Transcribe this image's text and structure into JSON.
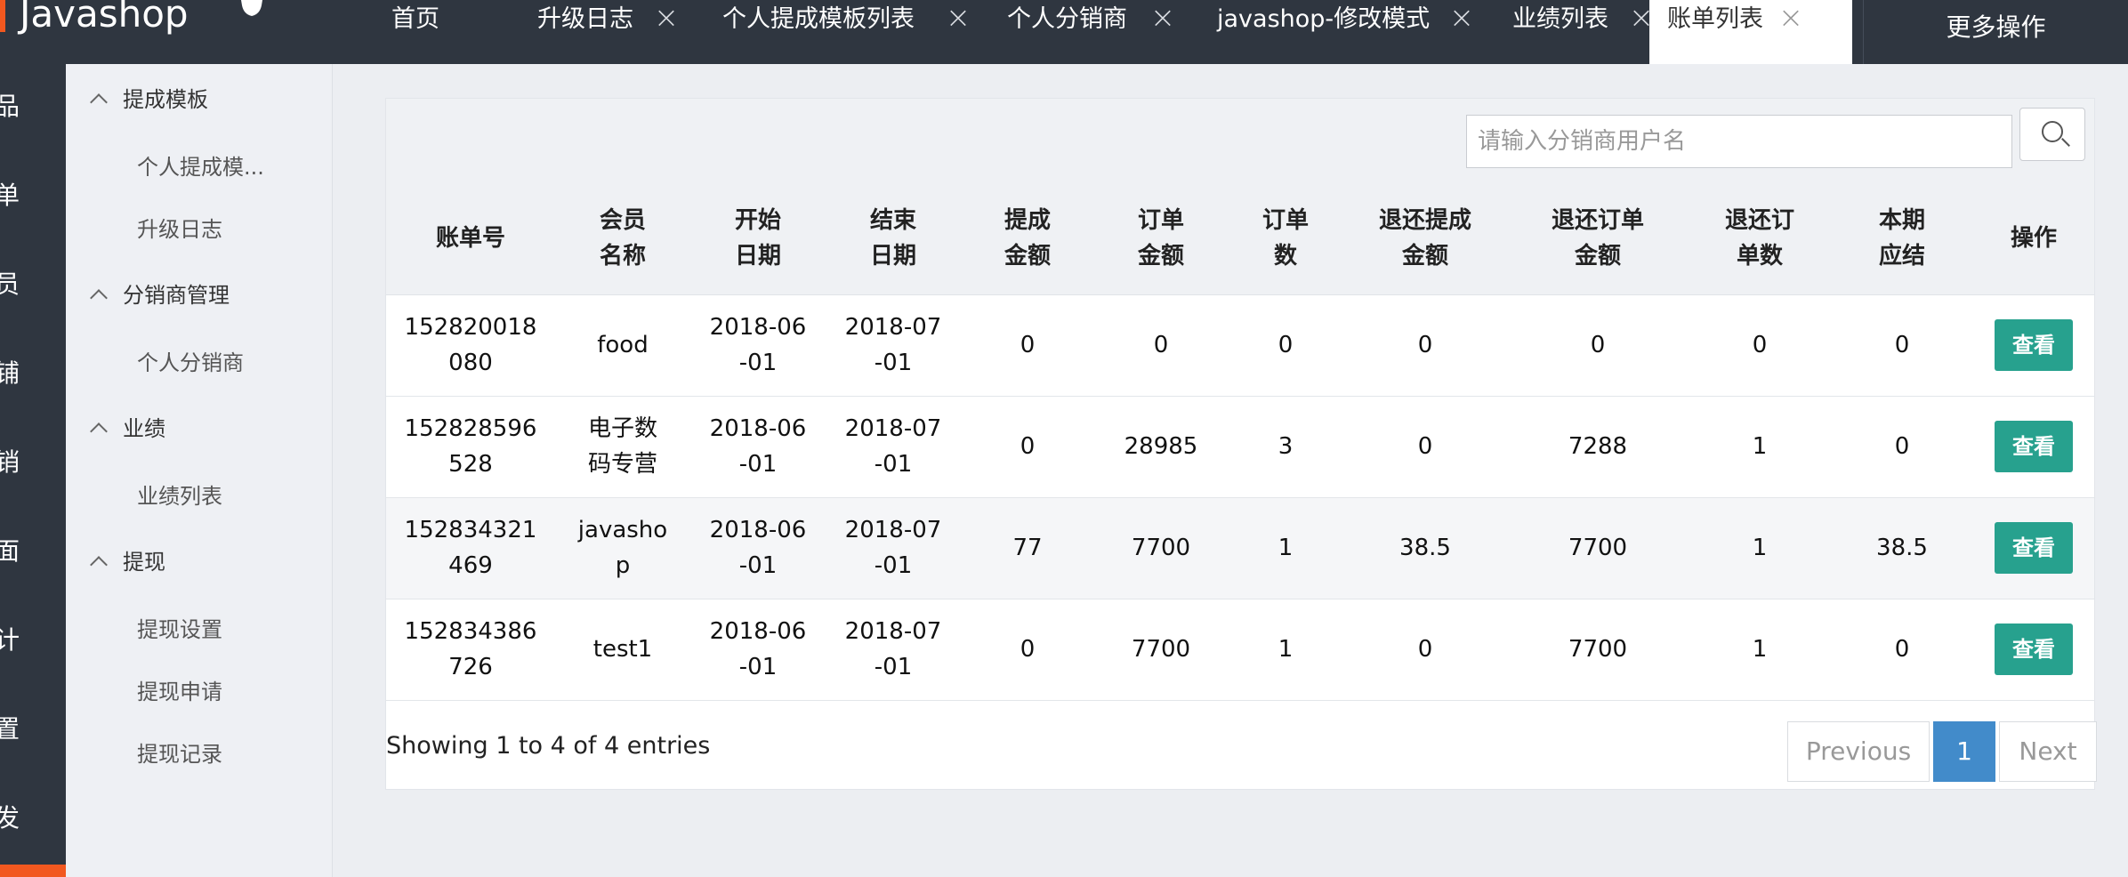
{
  "brand": {
    "name": "Javashop"
  },
  "tabs": [
    {
      "label": "首页",
      "closable": false
    },
    {
      "label": "升级日志",
      "closable": true
    },
    {
      "label": "个人提成模板列表",
      "closable": true
    },
    {
      "label": "个人分销商",
      "closable": true
    },
    {
      "label": "javashop-修改模式",
      "closable": true
    },
    {
      "label": "业绩列表",
      "closable": true
    },
    {
      "label": "账单列表",
      "closable": true,
      "active": true
    }
  ],
  "more_label": "更多操作",
  "iconbar": [
    "品",
    "单",
    "员",
    "铺",
    "销",
    "面",
    "计",
    "置",
    "发"
  ],
  "submenu": {
    "groups": [
      {
        "label": "提成模板",
        "items": [
          "个人提成模...",
          "升级日志"
        ]
      },
      {
        "label": "分销商管理",
        "items": [
          "个人分销商"
        ]
      },
      {
        "label": "业绩",
        "items": [
          "业绩列表"
        ]
      },
      {
        "label": "提现",
        "items": [
          "提现设置",
          "提现申请",
          "提现记录"
        ]
      }
    ]
  },
  "search": {
    "placeholder": "请输入分销商用户名",
    "value": ""
  },
  "table": {
    "headers": [
      [
        "账单号"
      ],
      [
        "会员",
        "名称"
      ],
      [
        "开始",
        "日期"
      ],
      [
        "结束",
        "日期"
      ],
      [
        "提成",
        "金额"
      ],
      [
        "订单",
        "金额"
      ],
      [
        "订单",
        "数"
      ],
      [
        "退还提成",
        "金额"
      ],
      [
        "退还订单",
        "金额"
      ],
      [
        "退还订",
        "单数"
      ],
      [
        "本期",
        "应结"
      ],
      [
        "操作"
      ]
    ],
    "rows": [
      [
        [
          "152820018",
          "080"
        ],
        [
          "food"
        ],
        [
          "2018-06",
          "-01"
        ],
        [
          "2018-07",
          "-01"
        ],
        [
          "0"
        ],
        [
          "0"
        ],
        [
          "0"
        ],
        [
          "0"
        ],
        [
          "0"
        ],
        [
          "0"
        ],
        [
          "0"
        ]
      ],
      [
        [
          "152828596",
          "528"
        ],
        [
          "电子数",
          "码专营"
        ],
        [
          "2018-06",
          "-01"
        ],
        [
          "2018-07",
          "-01"
        ],
        [
          "0"
        ],
        [
          "28985"
        ],
        [
          "3"
        ],
        [
          "0"
        ],
        [
          "7288"
        ],
        [
          "1"
        ],
        [
          "0"
        ]
      ],
      [
        [
          "152834321",
          "469"
        ],
        [
          "javasho",
          "p"
        ],
        [
          "2018-06",
          "-01"
        ],
        [
          "2018-07",
          "-01"
        ],
        [
          "77"
        ],
        [
          "7700"
        ],
        [
          "1"
        ],
        [
          "38.5"
        ],
        [
          "7700"
        ],
        [
          "1"
        ],
        [
          "38.5"
        ]
      ],
      [
        [
          "152834386",
          "726"
        ],
        [
          "test1"
        ],
        [
          "2018-06",
          "-01"
        ],
        [
          "2018-07",
          "-01"
        ],
        [
          "0"
        ],
        [
          "7700"
        ],
        [
          "1"
        ],
        [
          "0"
        ],
        [
          "7700"
        ],
        [
          "1"
        ],
        [
          "0"
        ]
      ]
    ],
    "action_label": "查看"
  },
  "info": "Showing 1 to 4 of 4 entries",
  "pager": {
    "previous": "Previous",
    "current": "1",
    "next": "Next"
  },
  "colors": {
    "topbar": "#2f3640",
    "accent": "#f2581f",
    "action": "#27a18e",
    "page_active": "#428bca"
  }
}
